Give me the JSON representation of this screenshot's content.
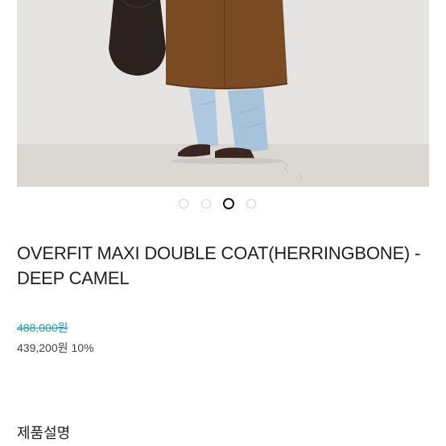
{
  "product": {
    "title": "OVERFIT MAXI DOUBLE COAT(HERRINGBONE) - DEEP CAMEL",
    "original_price": "488,000원",
    "sale_price": "439,200원",
    "discount": "10%",
    "image_alt_icon": "product-photo"
  },
  "carousel": {
    "total": 4,
    "active_index": 2
  },
  "sections": {
    "description_heading": "제품설명"
  },
  "colors": {
    "accent_strike": "#1aa1b5",
    "coat": "#7a4a22",
    "denim": "#a9c6dd"
  }
}
